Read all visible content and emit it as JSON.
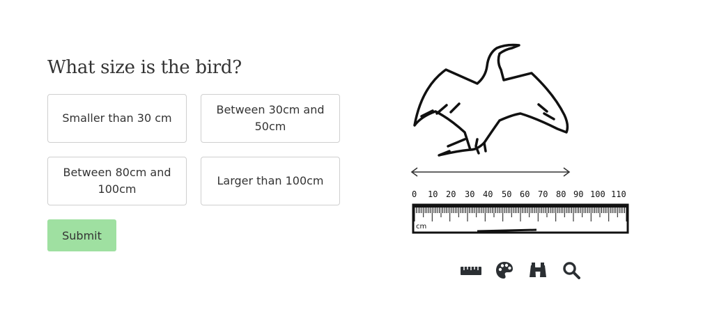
{
  "question": "What size is the bird?",
  "options": [
    "Smaller than 30 cm",
    "Between 30cm and 50cm",
    "Between 80cm and 100cm",
    "Larger than 100cm"
  ],
  "submit_label": "Submit",
  "ruler": {
    "ticks": [
      "0",
      "10",
      "20",
      "30",
      "40",
      "50",
      "60",
      "70",
      "80",
      "90",
      "100",
      "110"
    ],
    "unit": "cm"
  },
  "tools": [
    "ruler-icon",
    "palette-icon",
    "binoculars-icon",
    "magnifier-icon"
  ],
  "colors": {
    "submit": "#9fe0a1",
    "border": "#cfcfcf",
    "icon": "#2b2f33"
  }
}
